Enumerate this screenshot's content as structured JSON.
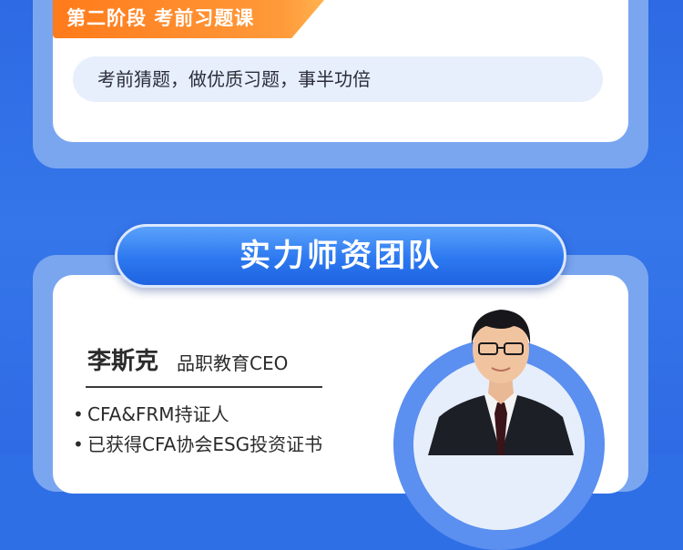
{
  "stage": {
    "label": "第二阶段 考前习题课",
    "desc": "考前猜题，做优质习题，事半功倍"
  },
  "section": {
    "title": "实力师资团队"
  },
  "teacher": {
    "name": "李斯克",
    "role": "品职教育CEO",
    "bullets": [
      "CFA&FRM持证人",
      "已获得CFA协会ESG投资证书"
    ]
  },
  "colors": {
    "background": "#2f6fe6",
    "card_border": "#7aa6f0",
    "tag": "#ff7a1a",
    "pill": "#e7eefc",
    "title_button": "#2c78f0"
  },
  "icons": {
    "bullet": "•"
  }
}
